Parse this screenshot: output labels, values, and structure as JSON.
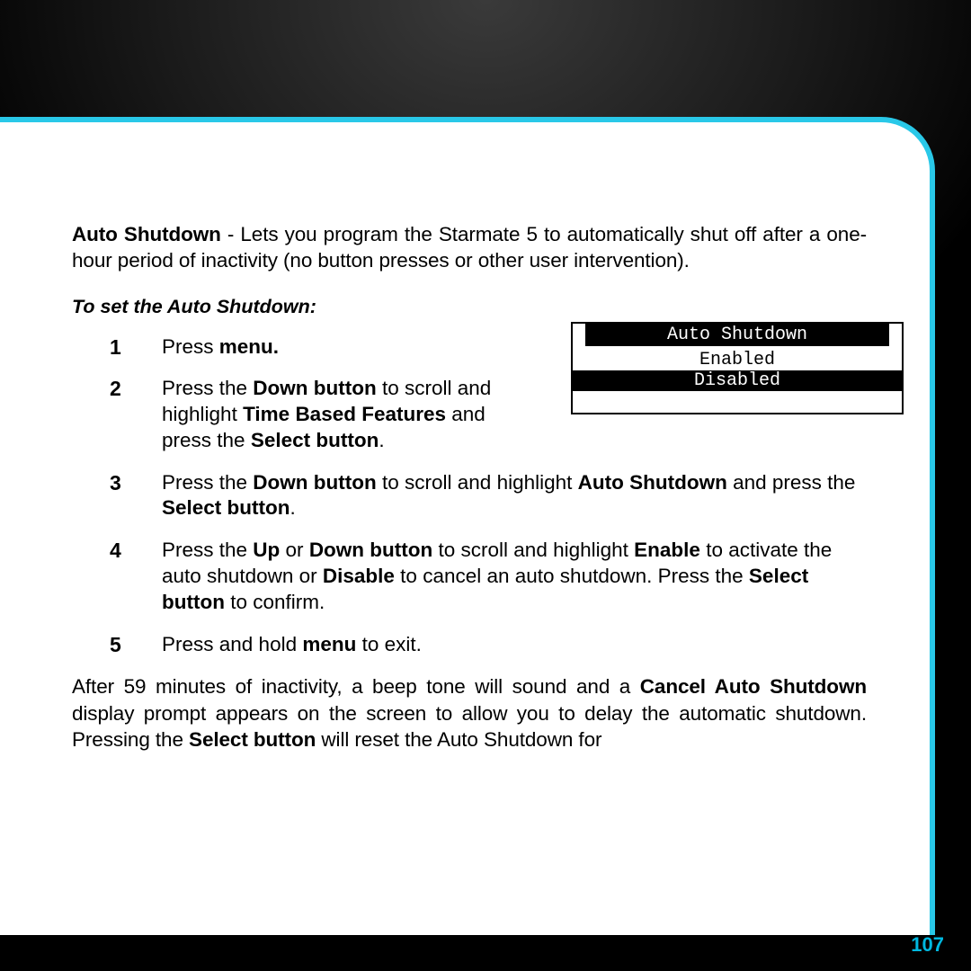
{
  "intro": {
    "featureLabel": "Auto Shutdown",
    "description": " - Lets you program the Starmate 5 to automatically shut off after a one-hour period of inactivity (no button presses or other user interven­tion)."
  },
  "subheading": "To set the Auto Shutdown:",
  "steps": {
    "s1": {
      "num": "1",
      "a": "Press ",
      "b": "menu."
    },
    "s2": {
      "num": "2",
      "a": "Press the ",
      "b": "Down button",
      "c": " to scroll and highlight ",
      "d": "Time Based Features",
      "e": " and press the ",
      "f": "Select button",
      "g": "."
    },
    "s3": {
      "num": "3",
      "a": "Press the ",
      "b": "Down button",
      "c": " to scroll and highlight ",
      "d": "Auto Shutdown",
      "e": " and press the ",
      "f": "Select button",
      "g": "."
    },
    "s4": {
      "num": "4",
      "a": "Press the ",
      "b": "Up",
      "c": " or ",
      "d": "Down button",
      "e": " to scroll and highlight ",
      "f": "Enable",
      "g": " to activate the auto shutdown or ",
      "h": "Disable",
      "i": " to cancel an auto shutdown. Press the ",
      "j": "Select button",
      "k": " to confirm."
    },
    "s5": {
      "num": "5",
      "a": "Press  and hold ",
      "b": "menu",
      "c": " to exit."
    }
  },
  "note": {
    "a": "After 59 minutes of inactivity, a beep tone will sound and a ",
    "b": "Cancel Auto Shut­down",
    "c": " display prompt appears on the screen to allow you to delay the auto­matic shutdown. Pressing the ",
    "d": "Select button",
    "e": " will reset the Auto Shutdown for"
  },
  "device": {
    "title": "Auto Shutdown",
    "option1": "Enabled",
    "option2": "Disabled"
  },
  "pageNumber": "107"
}
